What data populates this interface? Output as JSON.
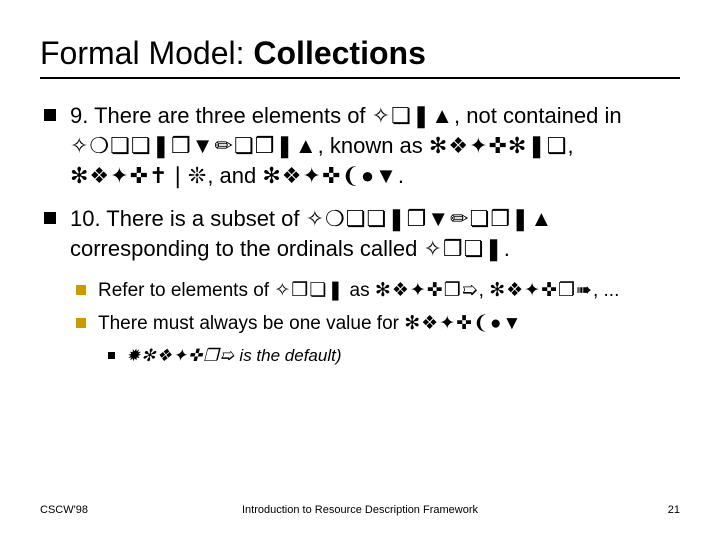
{
  "title_plain": "Formal Model: ",
  "title_bold": "Collections",
  "points": {
    "p1_a": "9. There are three elements of ",
    "p1_sym1": "✧❏❚▲",
    "p1_b": ", not contained in ",
    "p1_sym2": "✧❍❏❏❚❒▼✏❏❒❚▲",
    "p1_c": ", known as ",
    "p1_sym3": "✻❖✦✜✻❚❑",
    "p1_d": ", ",
    "p1_sym4": "✻❖✦✜✝❘❊",
    "p1_e": ", and ",
    "p1_sym5": "✻❖✦✜❨●▼",
    "p1_f": ".",
    "p2_a": "10. There is a subset of ",
    "p2_sym1": "✧❍❏❏❚❒▼✏❏❒❚▲",
    "p2_b": " corresponding to the ordinals called ",
    "p2_sym2": "✧❒❏❚",
    "p2_c": ".",
    "sub1_a": "Refer to elements of ",
    "sub1_sym1": "✧❒❏❚",
    "sub1_b": " as ",
    "sub1_sym2": "✻❖✦✜❐➯",
    "sub1_c": ", ",
    "sub1_sym3": "✻❖✦✜❐➠",
    "sub1_d": ", ...",
    "sub2_a": "There must always be one value for ",
    "sub2_sym1": "✻❖✦✜❨●▼",
    "sub3_a": "✹✻❖✦✜❐➯",
    "sub3_b": " is the default)"
  },
  "footer": {
    "left": "CSCW'98",
    "mid": "Introduction to Resource Description Framework",
    "right": "21"
  }
}
